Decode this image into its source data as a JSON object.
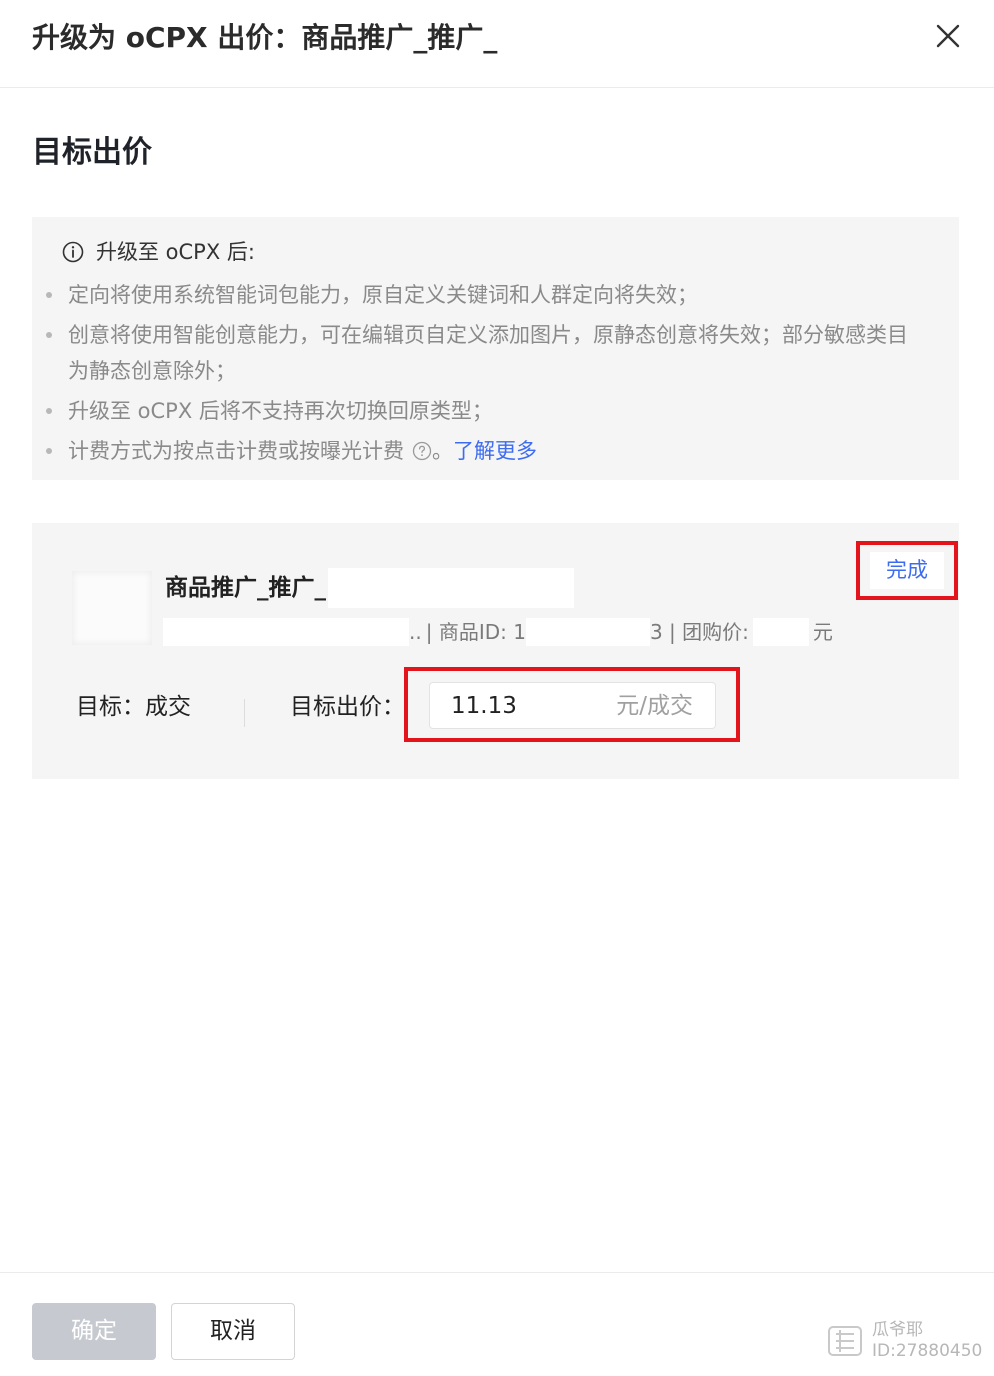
{
  "dialog": {
    "title": "升级为 oCPX 出价：商品推广_推广_"
  },
  "section": {
    "title": "目标出价"
  },
  "notice": {
    "heading": "升级至 oCPX 后:",
    "items": [
      "定向将使用系统智能词包能力，原自定义关键词和人群定向将失效；",
      "创意将使用智能创意能力，可在编辑页自定义添加图片，原静态创意将失效；部分敏感类目为静态创意除外；",
      "升级至 oCPX 后将不支持再次切换回原类型；"
    ],
    "last_item_text": "计费方式为按点击计费或按曝光计费",
    "last_item_suffix": "。",
    "learn_more": "了解更多"
  },
  "product": {
    "name": "商品推广_推广_",
    "meta_ellipsis": "..",
    "meta_id_label": "| 商品ID: 1",
    "meta_id_tail": "3 | 团购价:",
    "meta_price_unit": "元",
    "done_label": "完成",
    "goal_label": "目标：成交",
    "bid_label": "目标出价：",
    "bid_value": "11.13",
    "bid_unit": "元/成交"
  },
  "footer": {
    "confirm_label": "确定",
    "cancel_label": "取消"
  },
  "watermark": {
    "line1": "瓜爷耶",
    "line2": "ID:27880450"
  },
  "colors": {
    "accent_blue": "#3d6cf0",
    "highlight_red": "#e3141c",
    "panel_gray": "#f5f5f5",
    "disabled_button": "#c6c9cf"
  },
  "icons": {
    "close": "close-icon",
    "info": "info-circle-icon",
    "help": "question-circle-icon"
  }
}
